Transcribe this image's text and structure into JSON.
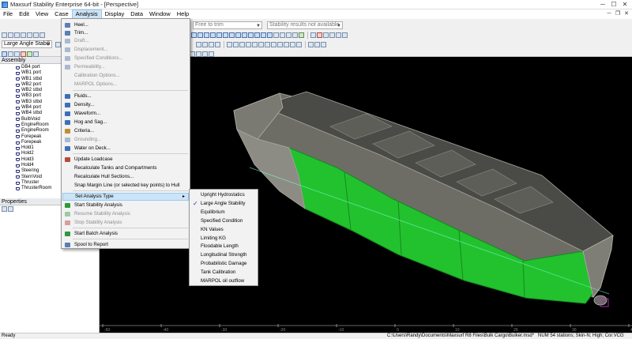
{
  "window": {
    "title": "Maxsurf Stability Enterprise 64-bit - [Perspective]",
    "controls": [
      "─",
      "☐",
      "✕"
    ],
    "mdi_controls": [
      "─",
      "❐",
      "✕"
    ]
  },
  "menubar": {
    "items": [
      "File",
      "Edit",
      "View",
      "Case",
      "Analysis",
      "Display",
      "Data",
      "Window",
      "Help"
    ],
    "active": "Analysis"
  },
  "toolbar": {
    "trim_select": "Free to trim",
    "stability_select": "Stability results not available",
    "analysis_type_select": "Large Angle Stabili"
  },
  "assembly_panel": {
    "title": "Assembly",
    "items": [
      "DB4 port",
      "WB1 port",
      "WB1 stbd",
      "WB2 port",
      "WB2 stbd",
      "WB3 port",
      "WB3 stbd",
      "WB4 port",
      "WB4 stbd",
      "BulbVoid",
      "EngineRoom",
      "EngineRoom",
      "Forepeak",
      "Forepeak",
      "Hold1",
      "Hold2",
      "Hold3",
      "Hold4",
      "Steering",
      "SternVoid",
      "Thruster",
      "ThrusterRoom"
    ]
  },
  "properties_panel": {
    "title": "Properties"
  },
  "analysis_menu": {
    "items": [
      {
        "label": "Heel...",
        "enabled": true,
        "icon": "heel-icon"
      },
      {
        "label": "Trim...",
        "enabled": true,
        "icon": "trim-icon"
      },
      {
        "label": "Draft...",
        "enabled": false,
        "icon": "draft-icon"
      },
      {
        "label": "Displacement...",
        "enabled": false,
        "icon": "displacement-icon"
      },
      {
        "label": "Specified Conditions...",
        "enabled": false,
        "icon": "specified-conditions-icon"
      },
      {
        "label": "Permeability...",
        "enabled": false,
        "icon": "permeability-icon"
      },
      {
        "label": "Calibration Options...",
        "enabled": false,
        "icon": ""
      },
      {
        "label": "MARPOL Options...",
        "enabled": false,
        "icon": ""
      },
      {
        "label": "Fluids...",
        "enabled": true,
        "icon": "fluids-icon"
      },
      {
        "label": "Density...",
        "enabled": true,
        "icon": "density-icon"
      },
      {
        "label": "Waveform...",
        "enabled": true,
        "icon": "waveform-icon"
      },
      {
        "label": "Hog and Sag...",
        "enabled": true,
        "icon": "hog-sag-icon"
      },
      {
        "label": "Criteria...",
        "enabled": true,
        "icon": "criteria-icon"
      },
      {
        "label": "Grounding...",
        "enabled": false,
        "icon": "grounding-icon"
      },
      {
        "label": "Water on Deck...",
        "enabled": true,
        "icon": "water-on-deck-icon"
      },
      {
        "label": "Update Loadcase",
        "enabled": true,
        "icon": "update-loadcase-icon"
      },
      {
        "label": "Recalculate Tanks and Compartments",
        "enabled": true,
        "icon": ""
      },
      {
        "label": "Recalculate Hull Sections...",
        "enabled": true,
        "icon": ""
      },
      {
        "label": "Snap Margin Line (or selected key points) to Hull",
        "enabled": true,
        "icon": ""
      },
      {
        "label": "Set Analysis Type",
        "enabled": true,
        "icon": "",
        "submenu": true
      },
      {
        "label": "Start Stability Analysis",
        "enabled": true,
        "icon": "start-analysis-icon"
      },
      {
        "label": "Resume Stability Analysis",
        "enabled": false,
        "icon": "resume-analysis-icon"
      },
      {
        "label": "Stop Stability Analysis",
        "enabled": false,
        "icon": "stop-analysis-icon"
      },
      {
        "label": "Start Batch Analysis",
        "enabled": true,
        "icon": "batch-analysis-icon"
      },
      {
        "label": "Spool to Report",
        "enabled": true,
        "icon": "spool-report-icon"
      }
    ]
  },
  "analysis_type_submenu": {
    "items": [
      "Upright Hydrostatics",
      "Large Angle Stability",
      "Equilibrium",
      "Specified Condition",
      "KN Values",
      "Limiting KG",
      "Floodable Length",
      "Longitudinal Strength",
      "Probabilistic Damage",
      "Tank Calibration",
      "MARPOL oil outflow"
    ],
    "checked": "Large Angle Stability"
  },
  "viewport": {
    "axis_labels": [
      "-50",
      "-40",
      "-30",
      "-20",
      "-10",
      "0",
      "10",
      "20",
      "30",
      "40"
    ],
    "hull_color": "#22c22e",
    "background": "#000000"
  },
  "statusbar": {
    "ready": "Ready",
    "path": "C:\\Users\\Randy\\Documents\\Maxsurf R8 Files\\Bulk Cargo\\Bulker.msd*",
    "info": "NUM  54 stations; Skin-N; High; Cor.VCG"
  },
  "colors": {
    "menu_highlight": "#cce4f7",
    "hull_green": "#22c22e",
    "hull_grey": "#8c8c84"
  }
}
